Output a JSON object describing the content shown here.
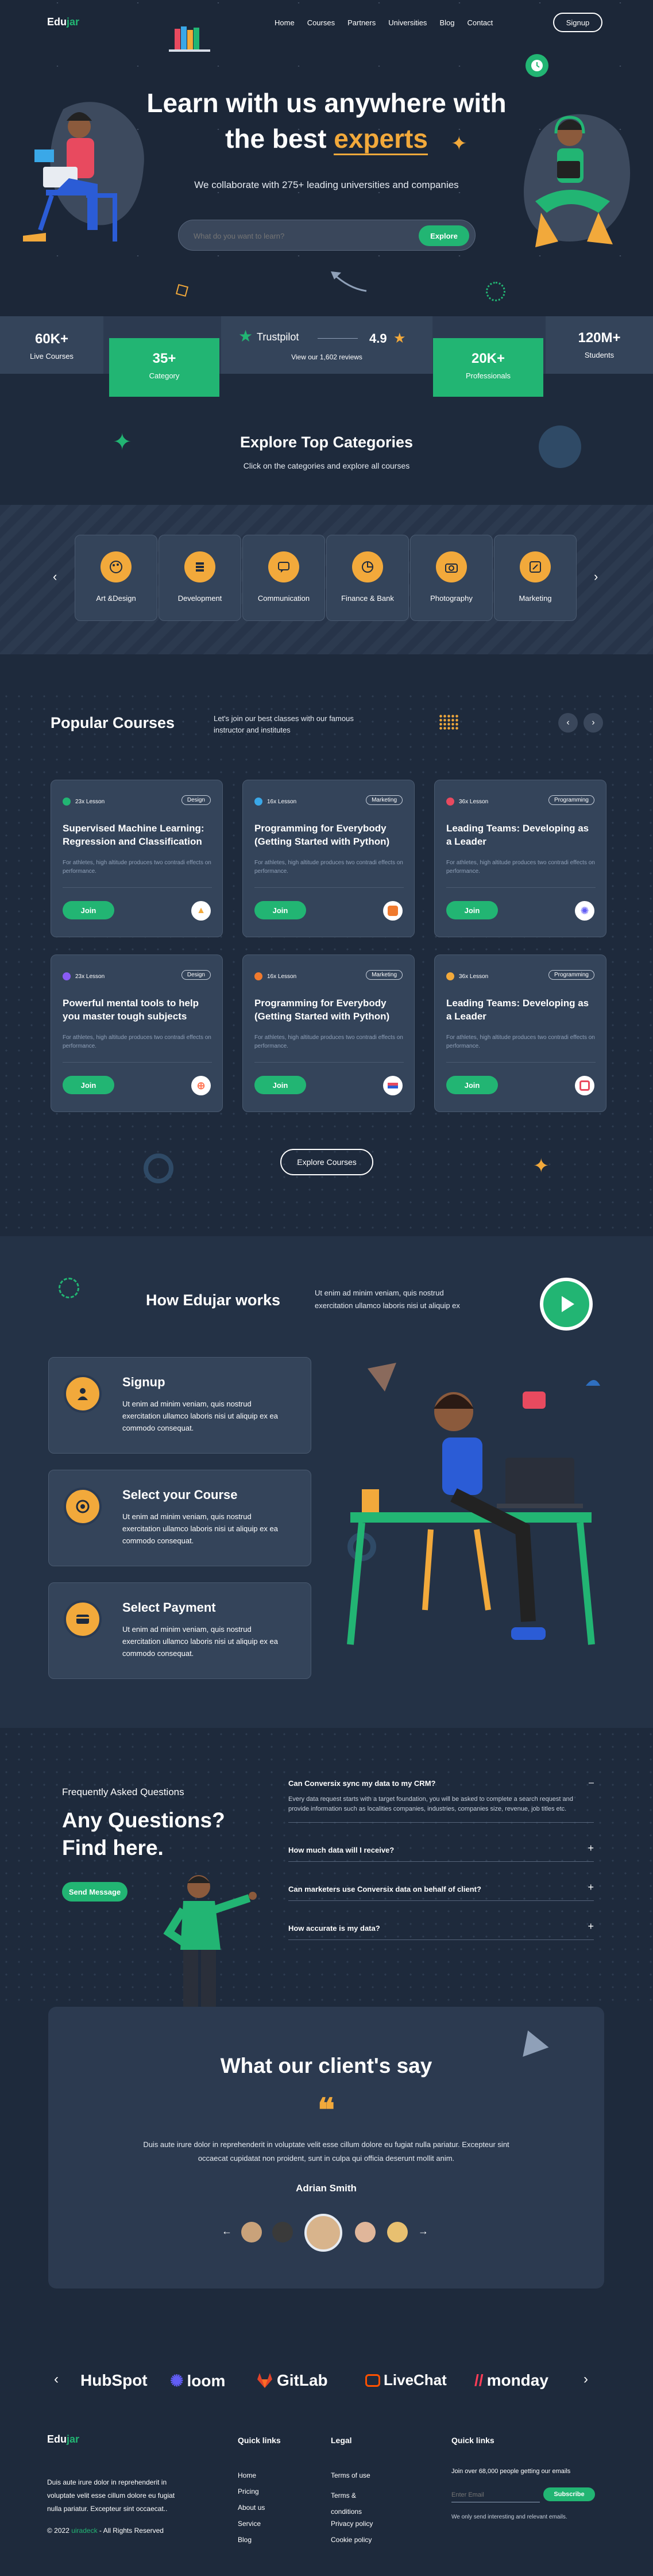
{
  "nav": {
    "logo_a": "Edu",
    "logo_b": "jar",
    "links": [
      "Home",
      "Courses",
      "Partners",
      "Universities",
      "Blog",
      "Contact"
    ],
    "signup": "Signup"
  },
  "hero": {
    "line1": "Learn with us anywhere with",
    "line2a": "the best ",
    "line2b": "experts",
    "sub": "We collaborate with 275+ leading universities and companies",
    "search_placeholder": "What do you want to learn?",
    "explore": "Explore"
  },
  "stats": {
    "live": {
      "num": "60K+",
      "label": "Live Courses"
    },
    "category": {
      "num": "35+",
      "label": "Category"
    },
    "trustpilot": {
      "brand": "Trustpilot",
      "rating": "4.9",
      "reviews": "View our 1,602 reviews"
    },
    "pros": {
      "num": "20K+",
      "label": "Professionals"
    },
    "students": {
      "num": "120M+",
      "label": "Students"
    }
  },
  "categories": {
    "title": "Explore Top Categories",
    "sub": "Click on the categories and explore all courses",
    "items": [
      "Art &Design",
      "Development",
      "Communication",
      "Finance & Bank",
      "Photography",
      "Marketing"
    ]
  },
  "popular": {
    "title": "Popular Courses",
    "desc": "Let's join our best classes with our famous instructor and institutes",
    "join": "Join",
    "card_desc": "For athletes, high altitude produces two contradi effects on performance.",
    "cards": [
      {
        "lessons": "23x Lesson",
        "tag": "Design",
        "title": "Supervised Machine Learning: Regression and Classification",
        "dot": "#22b573",
        "logo": "multicolor-logo-icon"
      },
      {
        "lessons": "16x Lesson",
        "tag": "Marketing",
        "title": "Programming for Everybody (Getting Started with Python)",
        "dot": "#3aa8e8",
        "logo": "orange-logo-icon"
      },
      {
        "lessons": "36x Lesson",
        "tag": "Programming",
        "title": "Leading Teams: Developing as a Leader",
        "dot": "#e84a5f",
        "logo": "purple-logo-icon"
      },
      {
        "lessons": "23x Lesson",
        "tag": "Design",
        "title": "Powerful mental tools to help you master tough subjects",
        "dot": "#8a5cf6",
        "logo": "hubspot-logo-icon"
      },
      {
        "lessons": "16x Lesson",
        "tag": "Marketing",
        "title": "Programming for Everybody (Getting Started with Python)",
        "dot": "#f07a2e",
        "logo": "red-blue-logo-icon"
      },
      {
        "lessons": "36x Lesson",
        "tag": "Programming",
        "title": "Leading Teams: Developing as a Leader",
        "dot": "#f2a93b",
        "logo": "red-square-logo-icon"
      }
    ],
    "explore_btn": "Explore Courses"
  },
  "how": {
    "title": "How Edujar works",
    "desc": "Ut enim ad minim veniam, quis nostrud exercitation ullamco laboris nisi ut aliquip ex",
    "step_desc": "Ut enim ad minim veniam, quis nostrud exercitation ullamco laboris nisi ut aliquip ex ea commodo consequat.",
    "steps": [
      "Signup",
      "Select your Course",
      "Select Payment"
    ]
  },
  "faq": {
    "eyebrow": "Frequently Asked Questions",
    "title1": "Any Questions?",
    "title2": "Find here.",
    "send": "Send Message",
    "items": [
      {
        "q": "Can Conversix sync my data to my CRM?",
        "a": "Every data request starts with a target foundation, you will be asked to complete a search request and provide information such as localities companies, industries, companies size, revenue, job titles etc.",
        "sign": "–"
      },
      {
        "q": "How much data will I receive?",
        "sign": "+"
      },
      {
        "q": "Can marketers use Conversix data on behalf of client?",
        "sign": "+"
      },
      {
        "q": "How accurate is my data?",
        "sign": "+"
      }
    ]
  },
  "testimonial": {
    "title": "What our client's say",
    "quote": "Duis aute irure dolor in reprehenderit in voluptate velit esse cillum dolore eu fugiat nulla pariatur. Excepteur sint occaecat cupidatat non proident, sunt in culpa qui officia deserunt mollit anim.",
    "name": "Adrian Smith"
  },
  "partners": [
    "HubSpot",
    "loom",
    "GitLab",
    "LiveChat",
    "monday"
  ],
  "footer": {
    "about": "Duis aute irure dolor in reprehenderit in voluptate velit esse cillum dolore eu fugiat nulla pariatur. Excepteur sint occaecat..",
    "copy_a": "© 2022 ",
    "copy_b": "uiradeck",
    "copy_c": " - All Rights Reserved",
    "quick_title": "Quick links",
    "quick": [
      "Home",
      "Pricing",
      "About us",
      "Service",
      "Blog"
    ],
    "legal_title": "Legal",
    "legal": [
      "Terms of use",
      "Terms & conditions",
      "Privacy policy",
      "Cookie policy"
    ],
    "news_title": "Quick links",
    "news_text": "Join over 68,000 people getting our emails",
    "email_placeholder": "Enter Email",
    "subscribe": "Subscribe",
    "news_note": "We only send interesting and relevant emails."
  },
  "colors": {
    "bg": "#1e2a3c",
    "green": "#22b573",
    "orange": "#f2a93b",
    "card": "#34445a"
  }
}
